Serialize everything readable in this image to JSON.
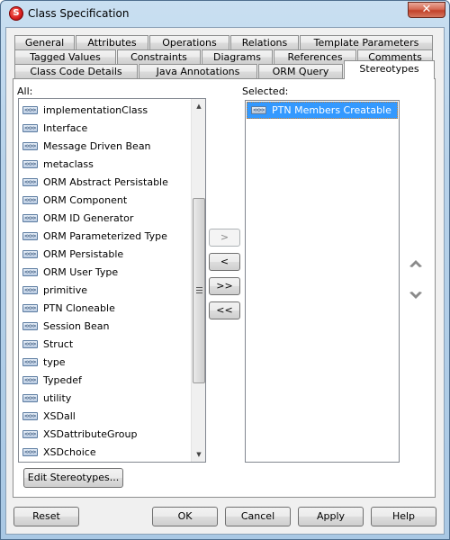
{
  "window": {
    "title": "Class Specification",
    "app_icon": "visual-paradigm-logo-icon",
    "close_icon": "close-icon"
  },
  "tabs": {
    "row1": [
      "General",
      "Attributes",
      "Operations",
      "Relations",
      "Template Parameters"
    ],
    "row2": [
      "Tagged Values",
      "Constraints",
      "Diagrams",
      "References",
      "Comments"
    ],
    "row3": [
      "Class Code Details",
      "Java Annotations",
      "ORM Query",
      "Stereotypes"
    ],
    "active": "Stereotypes"
  },
  "all_list": {
    "label": "All:",
    "items": [
      "implementationClass",
      "Interface",
      "Message Driven Bean",
      "metaclass",
      "ORM Abstract Persistable",
      "ORM Component",
      "ORM ID Generator",
      "ORM Parameterized Type",
      "ORM Persistable",
      "ORM User Type",
      "primitive",
      "PTN Cloneable",
      "Session Bean",
      "Struct",
      "type",
      "Typedef",
      "utility",
      "XSDall",
      "XSDattributeGroup",
      "XSDchoice"
    ],
    "item_icon": "stereotype-icon",
    "item_icon_glyph": "<<>>"
  },
  "selected_list": {
    "label": "Selected:",
    "items": [
      "PTN Members Creatable"
    ],
    "selected_index": 0
  },
  "transfer_buttons": {
    "add": ">",
    "remove": "<",
    "add_all": ">>",
    "remove_all": "<<"
  },
  "order_buttons": {
    "up_icon": "chevron-up-icon",
    "down_icon": "chevron-down-icon"
  },
  "edit_button": "Edit Stereotypes...",
  "footer": {
    "reset": "Reset",
    "ok": "OK",
    "cancel": "Cancel",
    "apply": "Apply",
    "help": "Help"
  },
  "colors": {
    "selection": "#3399ff",
    "close_button": "#c2412a",
    "window_frame": "#b7d2ea"
  }
}
